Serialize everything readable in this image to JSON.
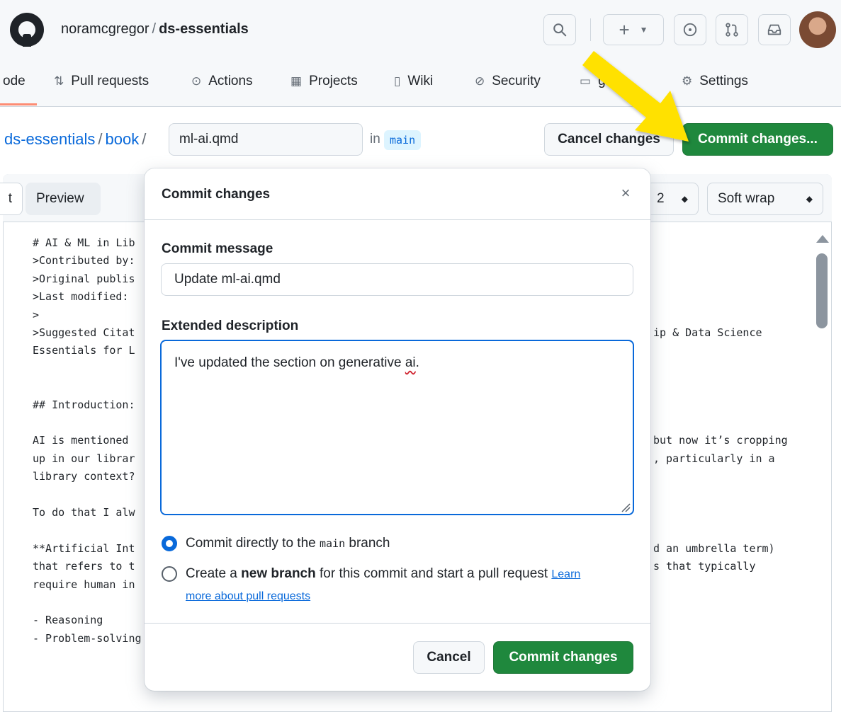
{
  "header": {
    "owner": "noramcgregor",
    "separator": "/",
    "repo": "ds-essentials",
    "tabs": [
      {
        "label": "ode",
        "icon": "code-icon"
      },
      {
        "label": "Pull requests",
        "icon": "git-pull-request-icon"
      },
      {
        "label": "Actions",
        "icon": "play-icon"
      },
      {
        "label": "Projects",
        "icon": "table-icon"
      },
      {
        "label": "Wiki",
        "icon": "book-icon"
      },
      {
        "label": "Security",
        "icon": "shield-icon"
      },
      {
        "label": "Insights",
        "icon": "graph-icon"
      },
      {
        "label": "Settings",
        "icon": "gear-icon"
      }
    ],
    "insights_visible_fragment": "ghts"
  },
  "breadcrumb": {
    "repo": "ds-essentials",
    "folder": "book",
    "sep": "/",
    "filename": "ml-ai.qmd",
    "in_label": "in",
    "branch": "main"
  },
  "actions": {
    "cancel_label": "Cancel changes",
    "commit_label": "Commit changes..."
  },
  "editor": {
    "edit_tab_fragment": "t",
    "preview_tab": "Preview",
    "indent_value": "2",
    "wrap_value": "Soft wrap",
    "left_lines": [
      "# AI & ML in Lib",
      ">Contributed by:",
      ">Original publis",
      ">Last modified:",
      ">",
      ">Suggested Citat",
      "Essentials for L",
      "",
      "",
      "## Introduction:",
      "",
      "AI is mentioned",
      "up in our librar",
      "library context?",
      "",
      "To do that I alw",
      "",
      "**Artificial Int",
      "that refers to t",
      "require human in",
      "",
      "- Reasoning",
      "- Problem-solving"
    ],
    "right_lines": [
      {
        "row": 5,
        "text": "ip & Data Science"
      },
      {
        "row": 11,
        "text": "but now it’s cropping"
      },
      {
        "row": 12,
        "text": ", particularly in a"
      },
      {
        "row": 17,
        "text": "d an umbrella term)"
      },
      {
        "row": 18,
        "text": "s that typically"
      }
    ]
  },
  "modal": {
    "title": "Commit changes",
    "close_glyph": "×",
    "message_label": "Commit message",
    "message_value": "Update ml-ai.qmd",
    "description_label": "Extended description",
    "description_text_before": "I've updated the section on generative ",
    "description_misspelled": "ai",
    "description_text_after": ".",
    "option_direct_pre": "Commit directly to the ",
    "option_direct_branch": "main",
    "option_direct_post": " branch",
    "option_new_pre": "Create a ",
    "option_new_bold": "new branch",
    "option_new_post": " for this commit and start a pull request ",
    "learn_more_line1": "Learn",
    "learn_more_line2": "more about pull requests",
    "cancel_label": "Cancel",
    "commit_label": "Commit changes"
  },
  "colors": {
    "primary_green": "#1f883d",
    "link_blue": "#0969da",
    "annotation_yellow": "#ffe100",
    "tab_underline": "#fd8c73"
  }
}
